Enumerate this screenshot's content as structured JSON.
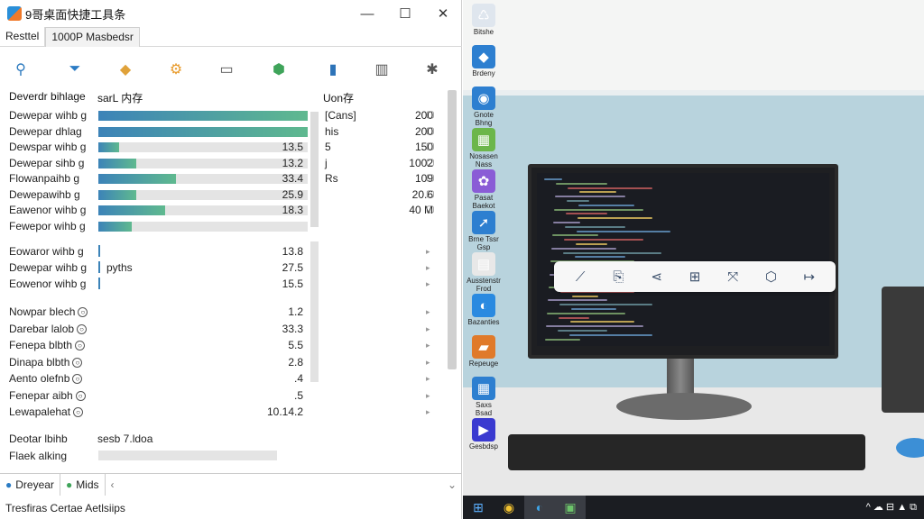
{
  "app": {
    "title": "9哥桌面快捷工具条",
    "window_buttons": {
      "minimize": "—",
      "maximize": "☐",
      "close": "✕"
    },
    "tabs": [
      "Resttel",
      "1000P Masbedsr"
    ],
    "toolbar_icons": [
      "tool-icon",
      "filter-icon",
      "tag-icon",
      "gear-icon",
      "layout-icon",
      "shield-icon",
      "document-icon",
      "bar-chart-icon",
      "settings-icon"
    ],
    "list_header": {
      "name": "Deverdr bihlage",
      "col2": "sarL 内存",
      "col3": "Uon存"
    },
    "rows_group1": [
      {
        "label": "Dewepar wihb g",
        "fill": 1.0,
        "value": "",
        "right": "[Cans]",
        "num": "200",
        "box": true
      },
      {
        "label": "Dewepar dhlag",
        "fill": 1.0,
        "value": "",
        "right": "his",
        "num": "200",
        "box": true
      },
      {
        "label": "Dewspar wihb g",
        "fill": 0.1,
        "value": "13.5",
        "right": "5",
        "num": "150",
        "box": true
      },
      {
        "label": "Dewepar sihb g",
        "fill": 0.18,
        "value": "13.2",
        "right": "j",
        "num": "1002",
        "box": true
      },
      {
        "label": "Flowanpaihb g",
        "fill": 0.37,
        "value": "33.4",
        "right": "Rs",
        "num": "109",
        "box": true
      },
      {
        "label": "Dewepawihb g",
        "fill": 0.18,
        "value": "25.9",
        "right": "",
        "num": "20.6",
        "box": true
      },
      {
        "label": "Eawenor wihb g",
        "fill": 0.32,
        "value": "18.3",
        "right": "",
        "num": "40 M",
        "box": true
      },
      {
        "label": "Fewepor wihb g",
        "fill": 0.16,
        "value": "",
        "right": "",
        "num": "",
        "box": false
      }
    ],
    "rows_group2": [
      {
        "label": "Eowaror wihb g",
        "value": "13.8",
        "extra": ""
      },
      {
        "label": "Dewepar wihb g",
        "value": "27.5",
        "extra": "pyths"
      },
      {
        "label": "Eowenor wihb g",
        "value": "15.5",
        "extra": ""
      }
    ],
    "rows_group3": [
      {
        "label": "Nowpar blech",
        "value": "1.2"
      },
      {
        "label": "Darebar lalob",
        "value": "33.3"
      },
      {
        "label": "Fenepa blbth",
        "value": "5.5"
      },
      {
        "label": "Dinapa blbth",
        "value": "2.8"
      },
      {
        "label": "Aento olefnb",
        "value": ".4"
      },
      {
        "label": "Fenepar aibh",
        "value": ".5"
      },
      {
        "label": "Lewapalehat",
        "value": "10.14.2"
      }
    ],
    "rows_group4": [
      {
        "label": "Deotar lbihb",
        "extra": "sesb 7.ldoa"
      },
      {
        "label": "Flaek alking",
        "extra": ""
      }
    ],
    "bottom_tabs": [
      "Dreyear",
      "Mids"
    ],
    "status": "Tresfiras Certae Aetlsiips"
  },
  "desktop": {
    "icons": [
      {
        "name": "recycle-bin-icon",
        "label": "Bitshe"
      },
      {
        "name": "app-shortcut-icon",
        "label": "Brdeny"
      },
      {
        "name": "browser-icon",
        "label": "Gnote Bhng"
      },
      {
        "name": "photo-icon",
        "label": "Nosasen Nass Pdds"
      },
      {
        "name": "flower-app-icon",
        "label": "Pasat Baekot Chs"
      },
      {
        "name": "arrow-app-icon",
        "label": "Brne Tssr Gsp"
      },
      {
        "name": "document-app-icon",
        "label": "Ausstenstr Frod"
      },
      {
        "name": "edge-icon",
        "label": "Bazanties"
      },
      {
        "name": "folder-app-icon",
        "label": "Repeuge"
      },
      {
        "name": "grid-app-icon",
        "label": "Saxs Bsad"
      },
      {
        "name": "media-app-icon",
        "label": "Gesbdsp"
      }
    ],
    "floatbar_icons": [
      "crop-icon",
      "pdf-icon",
      "share-icon",
      "grid-icon",
      "expand-icon",
      "box-icon",
      "redirect-icon"
    ]
  },
  "taskbar": {
    "items": [
      "windows-icon",
      "chrome-icon",
      "edge-icon",
      "app-icon"
    ],
    "tray": "^ ☁ ⊟ ▲ ⧉"
  }
}
